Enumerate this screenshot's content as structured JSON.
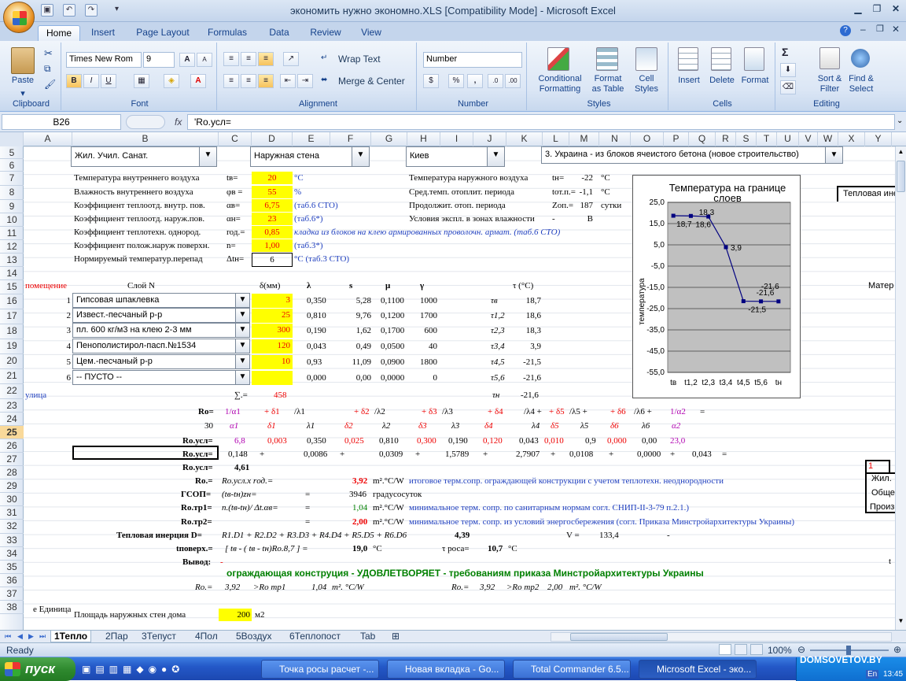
{
  "window": {
    "title": "экономить нужно экономно.XLS  [Compatibility Mode] - Microsoft Excel"
  },
  "ribbon": {
    "tabs": [
      "Home",
      "Insert",
      "Page Layout",
      "Formulas",
      "Data",
      "Review",
      "View"
    ],
    "clipboard": {
      "paste": "Paste",
      "label": "Clipboard"
    },
    "font": {
      "name": "Times New Rom",
      "size": "9",
      "label": "Font",
      "bold": "B",
      "italic": "I",
      "underline": "U",
      "grow": "A",
      "shrink": "A"
    },
    "alignment": {
      "wrap": "Wrap Text",
      "merge": "Merge & Center",
      "label": "Alignment"
    },
    "number": {
      "format": "Number",
      "label": "Number",
      "pct": "%",
      "comma": ","
    },
    "styles": {
      "cond": "Conditional",
      "cond2": "Formatting",
      "fmt": "Format",
      "fmt2": "as Table",
      "cell": "Cell",
      "cell2": "Styles",
      "label": "Styles"
    },
    "cells": {
      "insert": "Insert",
      "delete": "Delete",
      "format": "Format",
      "label": "Cells"
    },
    "editing": {
      "sort": "Sort &",
      "sort2": "Filter",
      "find": "Find &",
      "find2": "Select",
      "sigma": "Σ",
      "label": "Editing"
    }
  },
  "formulabar": {
    "namebox": "B26",
    "fx": "fx",
    "formula": "'Ro.усл="
  },
  "columns": [
    "A",
    "B",
    "C",
    "D",
    "E",
    "F",
    "G",
    "H",
    "I",
    "J",
    "K",
    "L",
    "M",
    "N",
    "O",
    "P",
    "Q",
    "R",
    "S",
    "T",
    "U",
    "V",
    "W",
    "X",
    "Y"
  ],
  "rows": [
    "5",
    "6",
    "7",
    "8",
    "9",
    "10",
    "11",
    "12",
    "13",
    "14",
    "15",
    "16",
    "17",
    "18",
    "19",
    "20",
    "21",
    "22",
    "23",
    "24",
    "25",
    "26",
    "27",
    "28",
    "29",
    "30",
    "31",
    "32",
    "33",
    "34",
    "35",
    "36",
    "37",
    "38"
  ],
  "dropdowns": {
    "building": "Жил. Учил. Санат.",
    "wall": "Наружная стена",
    "city": "Киев",
    "type": "3. Украина - из блоков ячеистого бетона (новое строительство)"
  },
  "params_left": [
    {
      "label": "Температура  внутреннего воздуха",
      "sym": "tв=",
      "val": "20",
      "note": "°C"
    },
    {
      "label": "Влажность  внутреннего воздуха",
      "sym": "φв =",
      "val": "55",
      "note": "%"
    },
    {
      "label": "Коэффициент теплоотд. внутр. пов.",
      "sym": "αв=",
      "val": "6,75",
      "note": "(таб.6 СТО)"
    },
    {
      "label": "Коэффициент теплоотд. наруж.пов.",
      "sym": "αн=",
      "val": "23",
      "note": "(таб.6*)"
    },
    {
      "label": "Коэффициент теплотехн. однород.",
      "sym": "rод.=",
      "val": "0,85",
      "note": "кладка из блоков на клею армированных проволочн. армат. (таб.6 СТО)"
    },
    {
      "label": "Коэффициент полож.наруж поверхн.",
      "sym": "n=",
      "val": "1,00",
      "note": "(таб.3*)"
    },
    {
      "label": "Нормируемый  температур.перепад",
      "sym": "Δtн=",
      "val": "6",
      "note": "°C   (таб.3 СТО)"
    }
  ],
  "params_right": [
    {
      "label": "Температура наружного воздуха",
      "sym": "tн=",
      "val": "-22",
      "unit": "°C"
    },
    {
      "label": "Сред.темп. отоплит. периода",
      "sym": "tот.п.=",
      "val": "-1,1",
      "unit": "°C"
    },
    {
      "label": "Продолжит. отоп. периода",
      "sym": "Zоп.=",
      "val": "187",
      "unit": "сутки"
    },
    {
      "label": "Условия экспл. в зонах влажности",
      "sym": "-",
      "val": "В",
      "unit": ""
    }
  ],
  "layer_header": {
    "room": "помещение",
    "layer": "Слой N",
    "delta": "δ(мм)",
    "lambda": "λ",
    "s": "s",
    "mu": "μ",
    "gamma": "γ",
    "tau": "τ (°C)"
  },
  "layers": [
    {
      "n": "1",
      "name": "Гипсовая шпаклевка",
      "d": "3",
      "l": "0,350",
      "s": "5,28",
      "mu": "0,1100",
      "g": "1000",
      "tl": "τв",
      "t": "18,7"
    },
    {
      "n": "2",
      "name": "Извест.-песчаный р-р",
      "d": "25",
      "l": "0,810",
      "s": "9,76",
      "mu": "0,1200",
      "g": "1700",
      "tl": "τ1,2",
      "t": "18,6"
    },
    {
      "n": "3",
      "name": "пл. 600 кг/м3 на клею 2-3 мм",
      "d": "300",
      "l": "0,190",
      "s": "1,62",
      "mu": "0,1700",
      "g": "600",
      "tl": "τ2,3",
      "t": "18,3"
    },
    {
      "n": "4",
      "name": "Пенополистирол-пасп.№1534",
      "d": "120",
      "l": "0,043",
      "s": "0,49",
      "mu": "0,0500",
      "g": "40",
      "tl": "τ3,4",
      "t": "3,9"
    },
    {
      "n": "5",
      "name": "Цем.-песчаный р-р",
      "d": "10",
      "l": "0,93",
      "s": "11,09",
      "mu": "0,0900",
      "g": "1800",
      "tl": "τ4,5",
      "t": "-21,5"
    },
    {
      "n": "6",
      "name": "-- ПУСТО --",
      "d": "",
      "l": "0,000",
      "s": "0,00",
      "mu": "0,0000",
      "g": "0",
      "tl": "τ5,6",
      "t": "-21,6"
    }
  ],
  "sum": {
    "room": "улица",
    "label": "∑.=",
    "val": "458",
    "tl": "τн",
    "t": "-21,6"
  },
  "r23": {
    "label": "Ro=",
    "c1": "1/α1",
    "c2": "+  δ1",
    "c3": "/λ1",
    "c4": "+ δ2",
    "c5": "/λ2",
    "c6": "+  δ3",
    "c7": "/λ3",
    "c8": "+  δ4",
    "c9": "/λ4 +",
    "c10": "+  δ5",
    "c11": "/λ5 +",
    "c12": "+  δ6",
    "c13": "/λ6 +",
    "c14": "1/α2",
    "c15": "="
  },
  "r24": {
    "a": "30",
    "c1": "α1",
    "c2": "δ1",
    "c3": "λ1",
    "c4": "δ2",
    "c5": "λ2",
    "c6": "δ3",
    "c7": "λ3",
    "c8": "δ4",
    "c9": "λ4",
    "c10": "δ5",
    "c11": "λ5",
    "c12": "δ6",
    "c13": "λ6",
    "c14": "α2"
  },
  "r25": {
    "label": "Ro.усл=",
    "v1": "6,8",
    "v2": "0,003",
    "v3": "0,350",
    "v4": "0,025",
    "v5": "0,810",
    "v6": "0,300",
    "v7": "0,190",
    "v8": "0,120",
    "v9": "0,043",
    "v10": "0,010",
    "v11": "0,9",
    "v12": "0,000",
    "v13": "0,00",
    "v14": "23,0"
  },
  "r26": {
    "label": "Ro.усл=",
    "v1": "0,148",
    "p": "+",
    "v3": "0,0086",
    "v5": "0,0309",
    "v7": "1,5789",
    "v9": "2,7907",
    "v11": "0,0108",
    "v13": "0,0000",
    "v14": "0,043",
    "eq": "="
  },
  "r27": {
    "label": "Ro.усл=",
    "val": "4,61"
  },
  "r28": {
    "label": "Ro.=",
    "f": "Ro.усл.х rод.=",
    "val": "3,92",
    "unit": "m².°C/W",
    "note": "итоговое терм.сопр. ограждающей конструкции с учетом теплотехн. неоднородности"
  },
  "r29": {
    "label": "ГСОП=",
    "f": "(tв-tн)zн=",
    "eq": "=",
    "val": "3946",
    "unit": "градусосуток"
  },
  "r30": {
    "label": "Ro.тр1=",
    "f": "n.(tв-tн)/ Δt.αв=",
    "eq": "=",
    "val": "1,04",
    "unit": "m².°C/W",
    "note": "минимальное терм. сопр. по санитарным нормам согл. СНИП-II-3-79 п.2.1.)"
  },
  "r31": {
    "label": "Ro.тр2=",
    "eq": "=",
    "val": "2,00",
    "unit": "m².°C/W",
    "note": "минимальное терм. сопр. из условий энергосбережения (согл. Приказа Минстройархитектуры Украины)"
  },
  "r32": {
    "label": "Тепловая инерция  D=",
    "f": "R1.D1 +  R2.D2 +  R3.D3 +  R4.D4 +  R5.D5 +  R6.D6",
    "val": "4,39",
    "v": "V =",
    "vval": "133,4",
    "dash": "-"
  },
  "r33": {
    "label": "tповерх.=",
    "f": "[ tв - ( tв - tн)Ro.8,7 ] =",
    "val": "19,0",
    "unit": "°C",
    "tr": "τ роса=",
    "trv": "10,7",
    "tru": "°C"
  },
  "r34": {
    "label": "Вывод:",
    "dash": "-"
  },
  "r35": {
    "text": "ограждающая конструция - УДОВЛЕТВОРЯЕТ - требованиям приказа Минстройархитектуры Украины"
  },
  "r36": {
    "a": "Ro.=",
    "b": "3,92",
    "c": ">Ro mp1",
    "d": "1,04",
    "e": "m². °C/W",
    "f": "Ro.=",
    "g": "3,92",
    "h": ">Ro mp2",
    "i": "2,00",
    "j": "m². °C/W"
  },
  "r38": {
    "a": "Площадь наружных стен дома",
    "val": "200",
    "unit": "м2",
    "pre": "е Единица"
  },
  "right_side": {
    "t1": "Тепловая ине",
    "mat": "Матер",
    "box1": "1",
    "z1": "Жил.",
    "z2": "Обще",
    "z3": "Произ",
    "t": "t"
  },
  "chart_data": {
    "type": "line",
    "title": "Температура на границе слоев",
    "ylabel": "температура",
    "categories": [
      "tв",
      "t1,2",
      "t2,3",
      "t3,4",
      "t4,5",
      "t5,6",
      "tн"
    ],
    "values": [
      18.7,
      18.6,
      18.3,
      3.9,
      -21.5,
      -21.6,
      -21.6
    ],
    "labels": [
      "18,7",
      "18,6",
      "18,3",
      "3,9",
      "-21,5",
      "-21,6",
      "-21,6"
    ],
    "yticks": [
      "25,0",
      "15,0",
      "5,0",
      "-5,0",
      "-15,0",
      "-25,0",
      "-35,0",
      "-45,0",
      "-55,0"
    ],
    "ylim": [
      -55,
      25
    ]
  },
  "sheets": [
    "1Тепло",
    "2Пар",
    "3Тепуст",
    "4Пол",
    "5Воздух",
    "6Теплопост",
    "Tab"
  ],
  "status": {
    "ready": "Ready",
    "zoom": "100%"
  },
  "taskbar": {
    "start": "пуск",
    "t1": "Точка росы расчет -...",
    "t2": "Новая вкладка - Go...",
    "t3": "Total Commander 6.5...",
    "t4": "Microsoft Excel - эко...",
    "lang": "En",
    "time": "13:45",
    "brand": "DOMSOVETOV.BY"
  }
}
